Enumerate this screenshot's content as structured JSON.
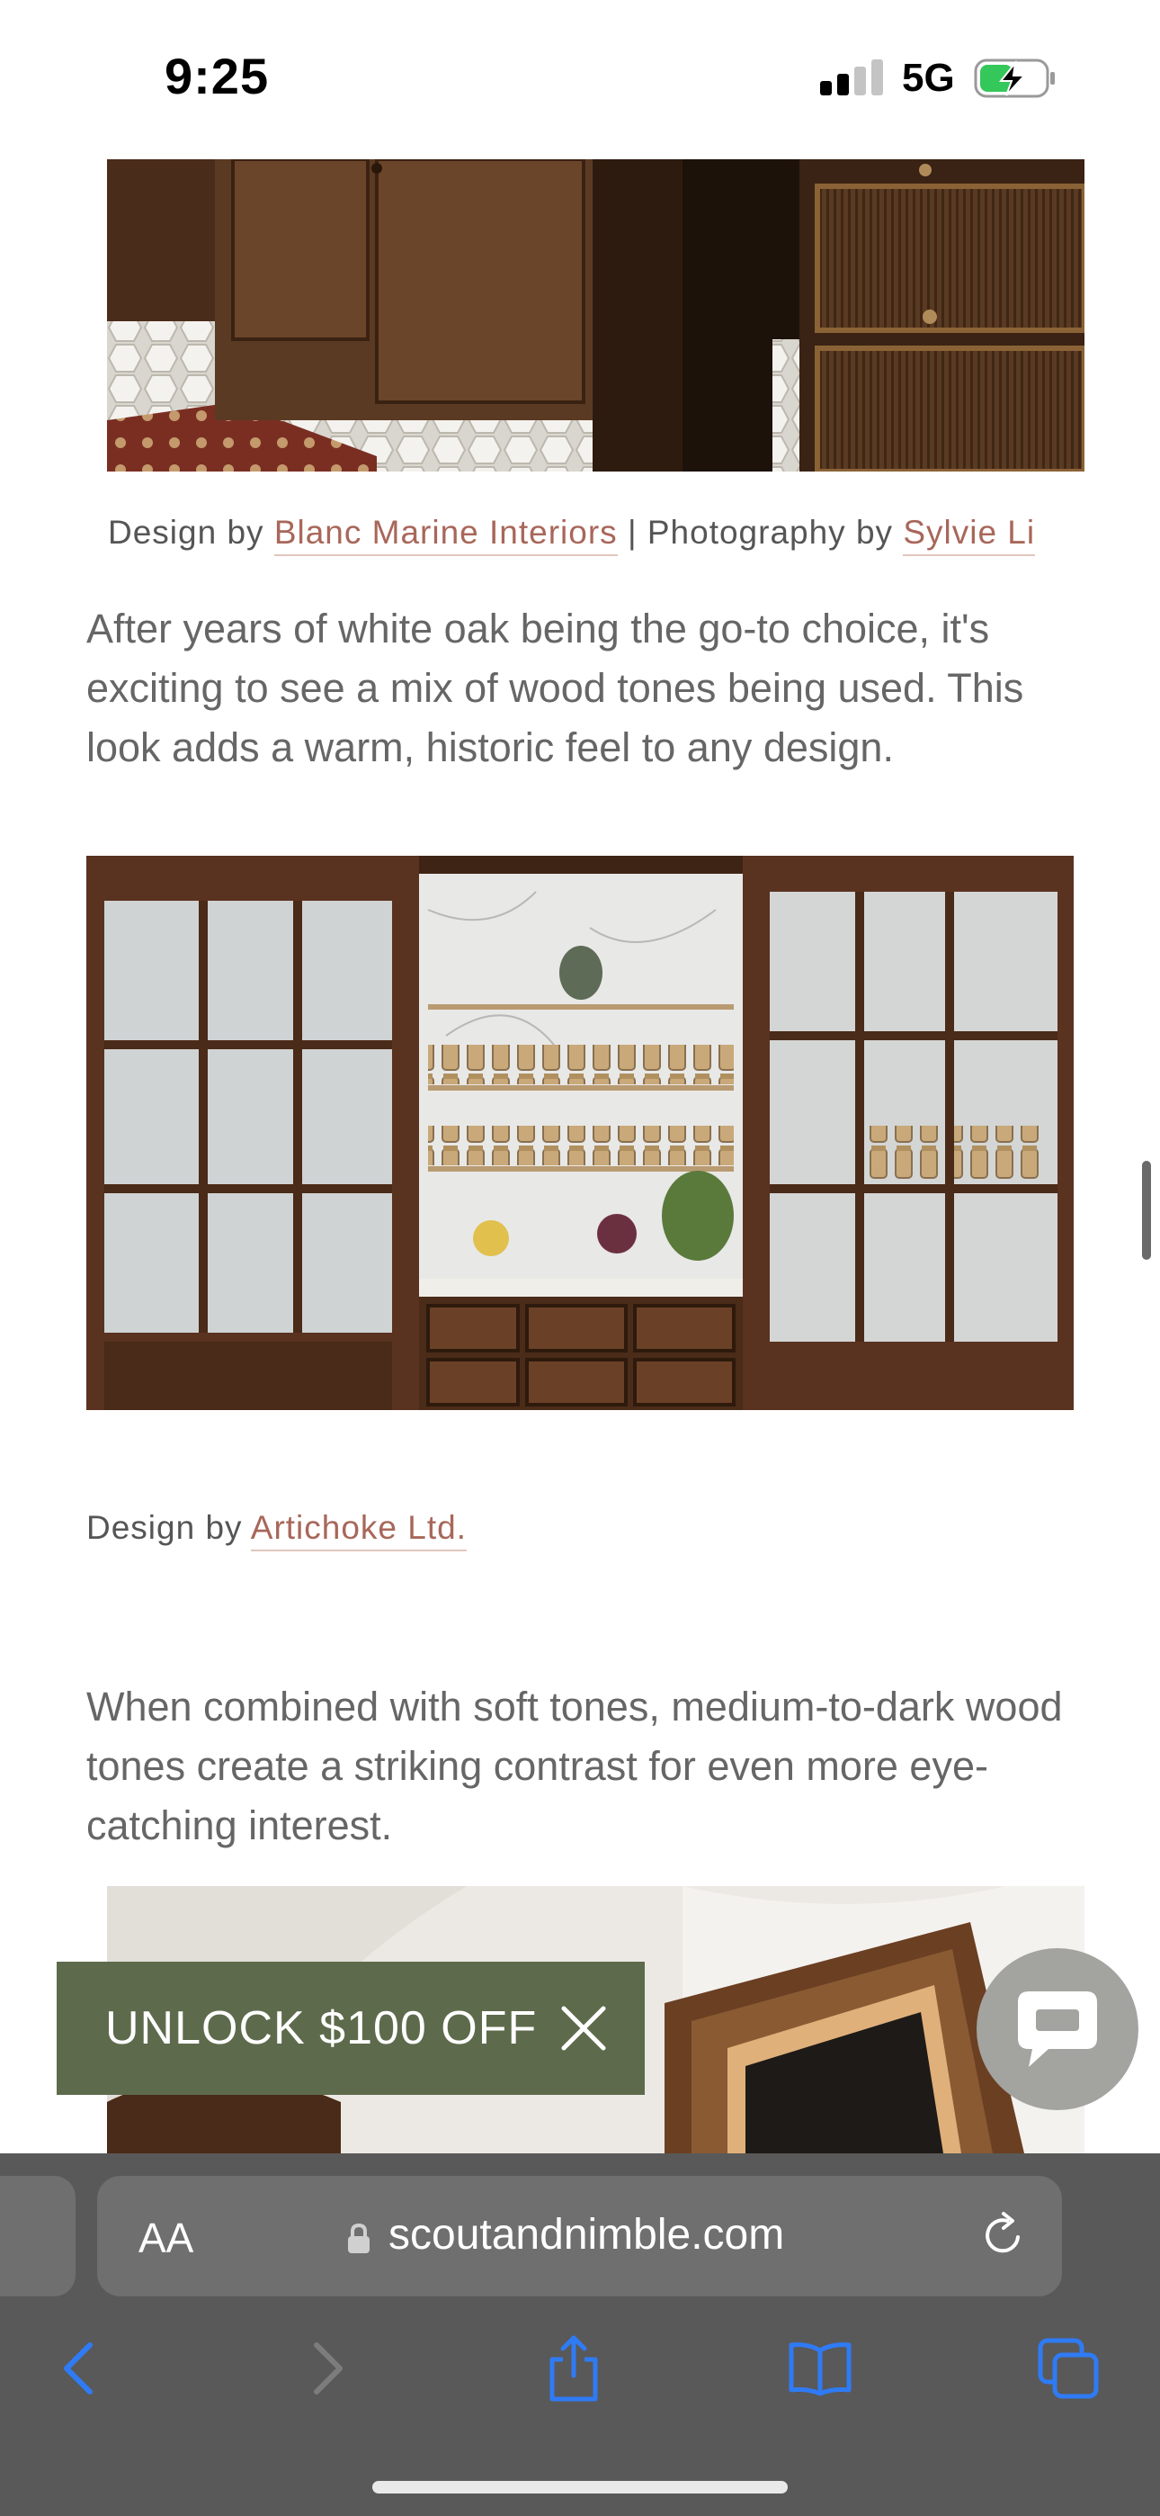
{
  "status_bar": {
    "time": "9:25",
    "network": "5G"
  },
  "article": {
    "caption_1": {
      "prefix": "Design by ",
      "designer_link": "Blanc Marine Interiors",
      "separator": " | Photography by ",
      "photographer_link": "Sylvie Li"
    },
    "paragraph_1": "After years of white oak being the go-to choice, it's exciting to see a mix of wood tones being used. This look adds a warm, historic feel to any design.",
    "caption_2": {
      "prefix": "Design by ",
      "designer_link": "Artichoke Ltd."
    },
    "paragraph_2": "When combined with soft tones, medium-to-dark wood tones create a striking contrast for even more eye-catching interest."
  },
  "promo": {
    "label": "UNLOCK $100 OFF",
    "icon": "close-icon",
    "color": "#5d6b4c"
  },
  "chat": {
    "icon": "chat-bubble-icon"
  },
  "browser": {
    "text_size_label": "AA",
    "url": "scoutandnimble.com",
    "icons": [
      "lock-icon",
      "reload-icon",
      "back-icon",
      "forward-icon",
      "share-icon",
      "bookmarks-icon",
      "tabs-icon"
    ],
    "accent": "#2f7bf5"
  }
}
